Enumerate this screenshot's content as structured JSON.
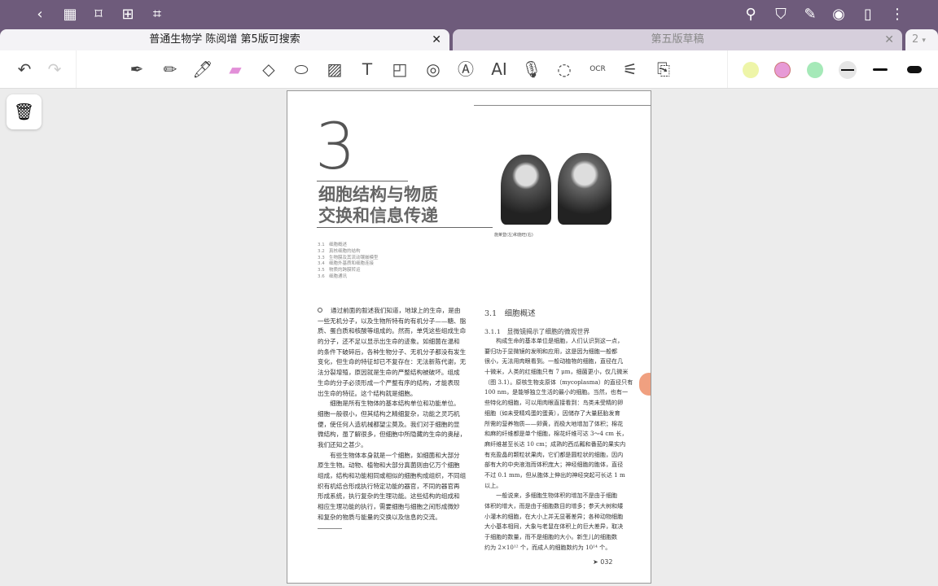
{
  "topbar": {
    "icons": [
      "back-icon",
      "grid-icon",
      "bookmark-icon",
      "add-page-icon",
      "crop-icon"
    ],
    "right_icons": [
      "search-icon",
      "shirt-icon",
      "pen-sign-icon",
      "eye-icon",
      "layout-icon",
      "more-icon"
    ]
  },
  "tabs": [
    {
      "label": "普通生物学 陈阅增 第5版可搜索",
      "active": true
    },
    {
      "label": "第五版草稿",
      "active": false
    }
  ],
  "tab_count": "2",
  "toolbar": {
    "ai_label": "AI",
    "ocr_label": "OCR",
    "colors": [
      "#eef5a8",
      "#e79ad6",
      "#a5e9b8"
    ]
  },
  "document": {
    "chapter_number": "3",
    "title_line1": "细胞结构与物质",
    "title_line2": "交换和信息传递",
    "caption": "施莱登(左)和施旺(右)",
    "toc": [
      {
        "num": "3.1",
        "label": "细胞概述"
      },
      {
        "num": "3.2",
        "label": "真核细胞的结构"
      },
      {
        "num": "3.3",
        "label": "生物膜及其流动镶嵌模型"
      },
      {
        "num": "3.4",
        "label": "细胞外基质和细胞连接"
      },
      {
        "num": "3.5",
        "label": "物质的跨膜转运"
      },
      {
        "num": "3.6",
        "label": "细胞通讯"
      }
    ],
    "left_lines": [
      "通过前面的叙述我们知道，地球上的生命，是由",
      "一些无机分子，以及生物所特有的有机分子——糖、脂",
      "质、蛋白质和核酸等组成的。然而，单凭这些组成生命",
      "的分子，还不足以显示出生命的迹象。如细菌在温和",
      "的条件下破碎后，各种生物分子、无机分子都没有发生",
      "变化，但生命的特征却已不复存在：无法新陈代谢，无",
      "法分裂增殖，原因就是生命的严整结构被破坏。组成",
      "生命的分子必须形成一个严整有序的结构，才能表现",
      "出生命的特征。这个结构就是细胞。",
      "　　细胞是所有生物体的基本结构单位和功能单位。",
      "细胞一般很小，但其结构之精细复杂，功能之灵巧机",
      "便，使任何人造机械都望尘莫及。我们对于细胞的显",
      "微结构，虽了解很多，但细胞中所隐藏的生命的奥秘，",
      "我们还知之甚少。",
      "　　有些生物体本身就是一个细胞，如细菌和大部分",
      "原生生物。动物、植物和大部分真菌则由亿万个细胞",
      "组成，结构和功能相同或相似的细胞构成组织，不同组",
      "织有机结合形成执行特定功能的器官，不同的器官再",
      "形成系统，执行复杂的生理功能。这些结构的组成和",
      "相应生理功能的执行，需要细胞与细胞之间形成微妙",
      "和复杂的物质与能量的交换以及信息的交流。"
    ],
    "section_heading": "3.1　细胞概述",
    "subsection_heading": "3.1.1　显微镜揭示了细胞的微观世界",
    "right_lines": [
      "　　构成生命的基本单位是细胞，人们认识到这一点，",
      "要归功于显微镜的发明和应用，这是因为细胞一般都",
      "很小，无法用肉眼看到。一般动植物的细胞，直径在几",
      "十微米，人类的红细胞只有 7 μm，细菌更小，仅几微米",
      "（图 3.1）。原核生物支原体（mycoplasma）的直径只有",
      "100 nm，是能够独立生活的最小的细胞。当然，也有一",
      "些特化的细胞，可以用肉眼直接看到：鸟类未受精的卵",
      "细胞（如未受精鸡蛋的蛋黄），因储存了大量胚胎发育",
      "所需的营养物质——卵黄，而极大地增加了体积；棉花",
      "和麻的纤维都是单个细胞，棉花纤维可达 3～4 cm 长，",
      "麻纤维甚至长达 10 cm；成熟的西瓜瓤和番茄的果实内",
      "有充盈晶的颗粒状果肉，它们都是圆粒状的细胞，因内",
      "部有大的中央液泡而体积庞大；神经细胞的胞体，直径",
      "不过 0.1 mm，但从胞体上伸出的神经突起可长达 1 m",
      "以上。",
      "　　一般说来，多细胞生物体积的增加不是由于细胞",
      "体积的增大，而是由于细胞数目的增多；参天大树和矮",
      "小灌木的细胞，在大小上并无显著差异；各种动物细胞",
      "大小基本相同，大象与老鼠在体积上的巨大差异，取决",
      "于细胞的数量，而不是细胞的大小。新生儿的细胞数",
      "约为 2×10¹² 个，而成人的细胞数约为 10¹⁴ 个。"
    ],
    "page_number": "032"
  }
}
